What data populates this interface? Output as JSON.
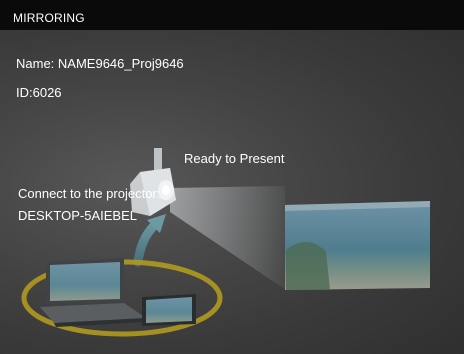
{
  "window": {
    "title": "MIRRORING"
  },
  "projector": {
    "name_text": "Name: NAME9646_Proj9646",
    "id_text": "ID:6026"
  },
  "status": {
    "message": "Ready to Present"
  },
  "connect": {
    "instruction": "Connect to the projector:",
    "device_name": "DESKTOP-5AIEBEL"
  },
  "colors": {
    "title_bar": "#0a0a0a",
    "background": "#3a3a3a",
    "arrow": "#5f8f98",
    "ring": "#b09a1f",
    "text": "#ffffff"
  },
  "icons": {
    "projector": "projector-icon",
    "screen": "projection-screen",
    "laptop": "laptop-icon",
    "phone": "smartphone-icon",
    "arrow": "curved-arrow-icon"
  }
}
